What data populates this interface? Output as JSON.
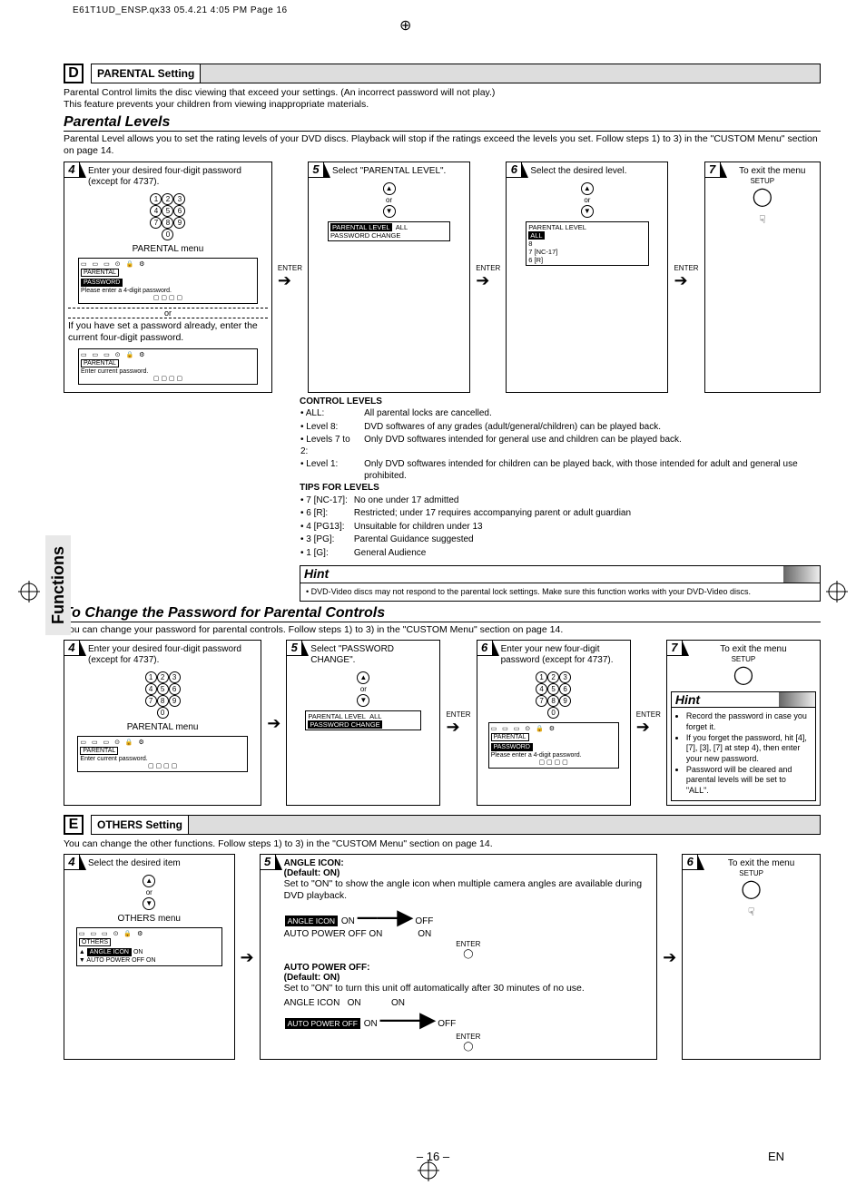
{
  "slug": "E61T1UD_ENSP.qx33  05.4.21 4:05 PM  Page 16",
  "side_tab": "Functions",
  "page_number": "– 16 –",
  "lang": "EN",
  "sectionD": {
    "letter": "D",
    "title": "PARENTAL Setting",
    "intro1": "Parental Control limits the disc viewing that exceed your settings. (An incorrect password will not play.)",
    "intro2": "This feature prevents your children from viewing inappropriate materials.",
    "levels_head": "Parental Levels",
    "levels_intro": "Parental Level allows you to set the rating levels of your DVD discs. Playback will stop if the ratings exceed the levels you set. Follow steps 1) to 3) in the \"CUSTOM Menu\" section on page 14.",
    "step4": "Enter your desired four-digit password (except for 4737).",
    "step5": "Select \"PARENTAL LEVEL\".",
    "step6": "Select the desired level.",
    "step7": "To exit the menu",
    "parental_menu_label": "PARENTAL menu",
    "or_text": "or",
    "already_pw": "If you have set a password already, enter the current four-digit password.",
    "menu5": {
      "l1": "PARENTAL LEVEL",
      "v1": "ALL",
      "l2": "PASSWORD CHANGE"
    },
    "menu6": {
      "l1": "PARENTAL LEVEL",
      "opts": [
        "ALL",
        "8",
        "7 [NC-17]",
        "6 [R]"
      ]
    },
    "setup": "SETUP",
    "enter": "ENTER",
    "control_head": "CONTROL LEVELS",
    "control_rows": [
      [
        "• ALL:",
        "All parental locks are cancelled."
      ],
      [
        "• Level 8:",
        "DVD softwares of any grades (adult/general/children) can be played back."
      ],
      [
        "• Levels 7 to 2:",
        "Only DVD softwares intended for general use and children can be played back."
      ],
      [
        "• Level 1:",
        "Only DVD softwares intended for children can be played back, with those intended for adult and general use prohibited."
      ]
    ],
    "tips_head": "TIPS FOR LEVELS",
    "tips_rows": [
      [
        "• 7 [NC-17]:",
        "No one under 17 admitted"
      ],
      [
        "• 6 [R]:",
        "Restricted; under 17 requires accompanying parent or adult guardian"
      ],
      [
        "• 4 [PG13]:",
        "Unsuitable for children under 13"
      ],
      [
        "• 3 [PG]:",
        "Parental Guidance suggested"
      ],
      [
        "• 1 [G]:",
        "General Audience"
      ]
    ],
    "hint_head": "Hint",
    "hint_body": "• DVD-Video discs may not respond to the parental lock settings. Make sure this function works with your DVD-Video discs.",
    "menu_gfx1_text": "Please enter a 4-digit password.",
    "menu_gfx2_text": "Enter current password."
  },
  "password": {
    "head": "To Change the Password for Parental Controls",
    "intro": "You can change your password for parental controls. Follow steps 1) to 3) in the \"CUSTOM Menu\" section on page 14.",
    "step4": "Enter your desired four-digit password (except for 4737).",
    "step5": "Select \"PASSWORD CHANGE\".",
    "step6": "Enter your new four-digit password (except for 4737).",
    "step7": "To exit the menu",
    "menu5": {
      "l1": "PARENTAL LEVEL",
      "v1": "ALL",
      "l2": "PASSWORD CHANGE"
    },
    "hint_head": "Hint",
    "hint_items": [
      "Record the password in case you forget it.",
      "If you forget the password, hit [4], [7], [3], [7] at step 4), then enter your new password.",
      "Password will be cleared and parental levels will be set to \"ALL\"."
    ],
    "parental_menu_label": "PARENTAL menu",
    "menu_gfx_text": "Enter current password.",
    "menu_gfx2_text": "Please enter a 4-digit password."
  },
  "sectionE": {
    "letter": "E",
    "title": "OTHERS Setting",
    "intro": "You can change the other functions. Follow steps 1) to 3) in the \"CUSTOM Menu\" section on page 14.",
    "step4": "Select the desired item",
    "step5_num": "5",
    "step6": "To exit the menu",
    "others_menu_label": "OTHERS menu",
    "angle_head": "ANGLE ICON:",
    "default_on": "(Default: ON)",
    "angle_body": "Set to \"ON\" to show the angle icon when multiple camera angles are available during DVD playback.",
    "auto_head": "AUTO POWER OFF:",
    "auto_body": "Set to \"ON\" to turn this unit off automatically after 30 minutes of no use.",
    "labels": {
      "angle": "ANGLE ICON",
      "auto": "AUTO POWER OFF",
      "on": "ON",
      "off": "OFF"
    },
    "menu_items": [
      "OTHERS",
      "ANGLE ICON",
      "AUTO POWER OFF"
    ]
  }
}
